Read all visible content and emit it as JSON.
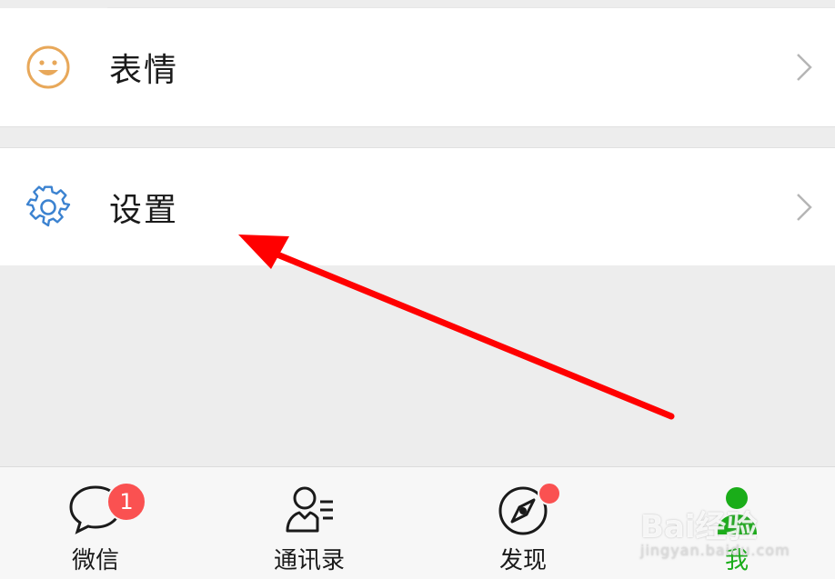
{
  "menu": {
    "emoji_label": "表情",
    "settings_label": "设置"
  },
  "tabs": [
    {
      "label": "微信",
      "badge": "1"
    },
    {
      "label": "通讯录"
    },
    {
      "label": "发现",
      "dot": true
    },
    {
      "label": "我",
      "active": true
    }
  ],
  "watermark": {
    "brand": "Bai经验",
    "site": "jingyan.baidu.com"
  },
  "colors": {
    "accent": "#1aad19",
    "badge": "#fa5151",
    "arrow": "#ff0000",
    "emoji_icon": "#e8a85a",
    "settings_icon": "#3b82d0"
  }
}
